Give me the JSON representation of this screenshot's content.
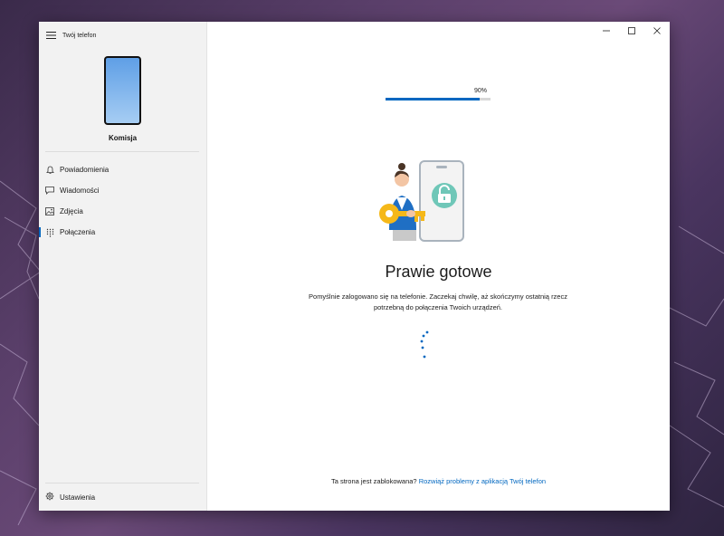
{
  "app": {
    "title": "Twój telefon"
  },
  "device": {
    "name": "Komisja"
  },
  "sidebar": {
    "items": [
      {
        "label": "Powiadomienia",
        "icon": "bell-icon"
      },
      {
        "label": "Wiadomości",
        "icon": "message-icon"
      },
      {
        "label": "Zdjęcia",
        "icon": "photo-icon"
      },
      {
        "label": "Połączenia",
        "icon": "dialpad-icon",
        "active": true
      }
    ],
    "settings_label": "Ustawienia"
  },
  "progress": {
    "label": "90%",
    "value": 0.9
  },
  "main": {
    "heading": "Prawie gotowe",
    "description": "Pomyślnie zalogowano się na telefonie. Zaczekaj chwilę, aż skończymy ostatnią rzecz potrzebną do połączenia Twoich urządzeń.",
    "footer_text": "Ta strona jest zablokowana?",
    "footer_link": "Rozwiąż problemy z aplikacją Twój telefon"
  },
  "colors": {
    "accent": "#0067c0",
    "phone_screen": "#7fb6ea"
  }
}
